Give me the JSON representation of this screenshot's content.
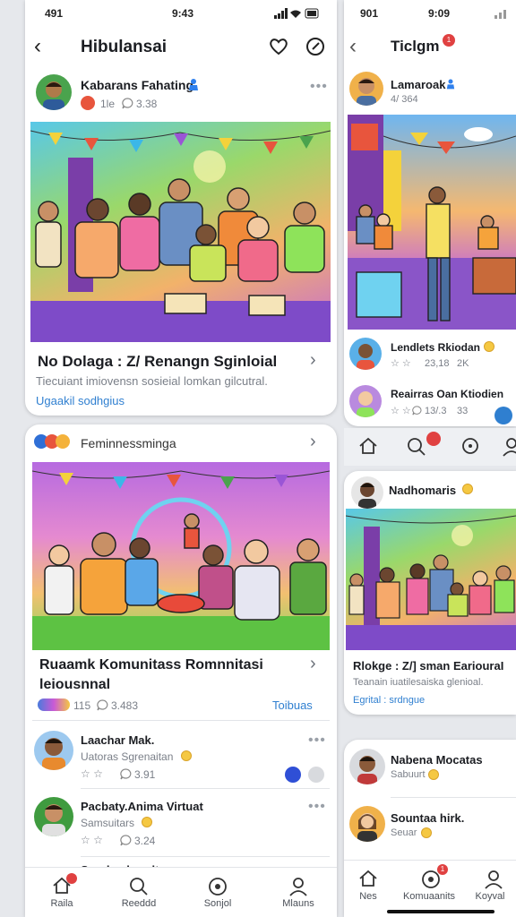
{
  "left": {
    "status": {
      "time_left": "491",
      "time_right": "9:43"
    },
    "header": {
      "title": "Hibulansai"
    },
    "post1": {
      "author": "Kabarans Fahating",
      "meta_label": "1le",
      "meta_count": "3.38",
      "title": "No Dolaga : Z/ Renangn Sginloial",
      "description": "Tiecuiant imiovensn sosieial lomkan gilcutral.",
      "link": "Ugaakil sodhgius"
    },
    "post2": {
      "group": "Feminnessminga",
      "title_line1": "Ruaamk Komunitass Romnnitasi",
      "title_line2": "leiousnnal",
      "count1": "115",
      "count2": "3.483",
      "action": "Toibuas"
    },
    "list": [
      {
        "name": "Laachar Mak.",
        "sub": "Uatoras Sgrenaitan",
        "count": "3.91"
      },
      {
        "name": "Pacbaty.Anima Virtuat",
        "sub": "Samsuitars",
        "count": "3.24"
      }
    ],
    "partial_name": "Sagrlamhuudt",
    "nav": {
      "home": "Raila",
      "search": "Reeddd",
      "explore": "Sonjol",
      "profile": "Mlauns"
    }
  },
  "right": {
    "status": {
      "time_left": "901",
      "time_right": "9:09"
    },
    "header": {
      "title": "Ticlgm",
      "badge": "1"
    },
    "profile": {
      "name": "Lamaroak",
      "meta": "4/ 364"
    },
    "rows": [
      {
        "name": "Lendlets Rkiodan",
        "count": "23,18",
        "count2": "2K"
      },
      {
        "name": "Reairras Oan Ktiodien",
        "count": "13/.3",
        "count2": "33"
      }
    ],
    "card": {
      "author": "Nadhomaris",
      "title": "Rlokge : Z/] sman EariouraI",
      "description": "Teanain iuatilesaiska glenioal.",
      "link": "Egrital : srdngue"
    },
    "mini": [
      {
        "name": "Nabena Mocatas",
        "sub": "Sabuurt"
      },
      {
        "name": "Sountaa hirk.",
        "sub": "Seuar"
      }
    ],
    "nav": {
      "home": "Nes",
      "community": "Komuaanits",
      "profile": "Koyval",
      "badge": "1"
    }
  },
  "colors": {
    "accent": "#2f7fd0",
    "badge": "#e04141",
    "verified": "#2f80ed"
  }
}
